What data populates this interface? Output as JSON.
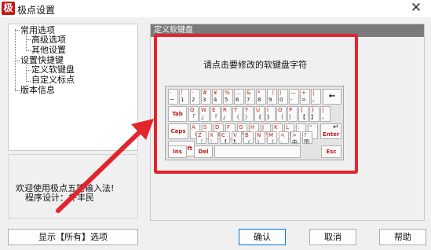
{
  "window": {
    "title": "极点设置",
    "icon_glyph": "极",
    "close_glyph": "✕"
  },
  "tree": {
    "items": [
      {
        "label": "常用选项"
      },
      {
        "label": "高级选项"
      },
      {
        "label": "其他设置"
      },
      {
        "label": "设置快捷键"
      },
      {
        "label": "定义软键盘"
      },
      {
        "label": "自定义标点"
      },
      {
        "label": "版本信息"
      }
    ]
  },
  "info": {
    "line1": "欢迎使用极点五笔输入法!",
    "line2": "程序设计：朴丰民"
  },
  "show_all_button": "显示【所有】选项",
  "group": {
    "header": "定义软键盘",
    "prompt": "请点击要修改的软键盘字符"
  },
  "keyboard": {
    "row1": [
      {
        "sym": "·",
        "main": "~"
      },
      {
        "sym": "！",
        "main": "1"
      },
      {
        "sym": "·",
        "main": "2"
      },
      {
        "sym": "#",
        "main": "3"
      },
      {
        "sym": "¥",
        "main": "4"
      },
      {
        "sym": "%",
        "main": "5"
      },
      {
        "sym": "…",
        "main": "6"
      },
      {
        "sym": "&",
        "main": "7"
      },
      {
        "sym": "*",
        "main": "8"
      },
      {
        "sym": "（",
        "main": "9"
      },
      {
        "sym": "）",
        "main": "0"
      },
      {
        "sym": "—",
        "main": "-"
      },
      {
        "sym": "+",
        "main": "="
      },
      {
        "sym": "|",
        "main": "、"
      }
    ],
    "backspace": "←",
    "row2": [
      {
        "sym": "Q",
        "main": "「"
      },
      {
        "sym": "W",
        "main": "」"
      },
      {
        "sym": "E",
        "main": "『"
      },
      {
        "sym": "R",
        "main": "』"
      },
      {
        "sym": "T",
        "main": "〈"
      },
      {
        "sym": "Y",
        "main": "〉"
      },
      {
        "sym": "U",
        "main": "《"
      },
      {
        "sym": "I",
        "main": "》"
      },
      {
        "sym": "O",
        "main": "〔"
      },
      {
        "sym": "P",
        "main": "〕"
      },
      {
        "sym": "{",
        "main": "【"
      },
      {
        "sym": "}",
        "main": "】"
      },
      {
        "sym": "|",
        "main": "、"
      }
    ],
    "tab": "Tab",
    "row3": [
      {
        "sym": "A",
        "main": "〈"
      },
      {
        "sym": "S",
        "main": "〉"
      },
      {
        "sym": "D",
        "main": "《"
      },
      {
        "sym": "F",
        "main": "》"
      },
      {
        "sym": "G",
        "main": "「"
      },
      {
        "sym": "H",
        "main": "」"
      },
      {
        "sym": "J",
        "main": "『"
      },
      {
        "sym": "K",
        "main": "』"
      },
      {
        "sym": "L",
        "main": "〔"
      },
      {
        "sym": ":",
        "main": "；"
      },
      {
        "sym": "\"",
        "main": "’"
      }
    ],
    "caps": "Caps",
    "enter": "Enter",
    "enter_arrow": "↵",
    "row4": [
      {
        "sym": "Z",
        "main": "〖"
      },
      {
        "sym": "X",
        "main": "〗"
      },
      {
        "sym": "C",
        "main": "【"
      },
      {
        "sym": "V",
        "main": "】"
      },
      {
        "sym": "B",
        "main": "〈"
      },
      {
        "sym": "N",
        "main": "〉"
      },
      {
        "sym": "M",
        "main": "〔"
      },
      {
        "sym": "<",
        "main": "，"
      },
      {
        "sym": ">",
        "main": "中"
      },
      {
        "sym": "?",
        "main": "国"
      }
    ],
    "shift": "Shift",
    "shift_arrow": "⬆",
    "ins": "Ins",
    "del": "Del",
    "esc": "Esc"
  },
  "buttons": {
    "ok": "确认",
    "cancel": "取消",
    "help": "帮助"
  },
  "colors": {
    "highlight": "#e2242c",
    "key_symbol": "#c01a1a",
    "group_header": "#7a7a7a"
  }
}
